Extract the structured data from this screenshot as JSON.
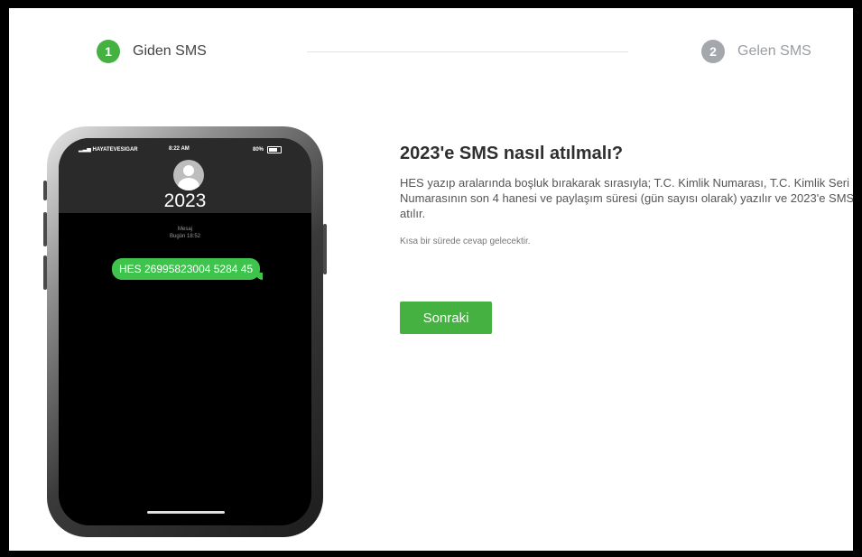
{
  "stepper": {
    "steps": [
      {
        "number": "1",
        "label": "Giden SMS",
        "state": "active"
      },
      {
        "number": "2",
        "label": "Gelen SMS",
        "state": "inactive"
      }
    ]
  },
  "phone": {
    "status_bar": {
      "carrier": "HAYATEVESIGAR",
      "time": "8:22 AM",
      "battery": "80%"
    },
    "contact_name": "2023",
    "message_label": "Mesaj",
    "message_time": "Bugün 18:52",
    "sms_text": "HES 26995823004 5284 45"
  },
  "content": {
    "title": "2023'e SMS nasıl atılmalı?",
    "description": "HES yazıp aralarında boşluk bırakarak sırasıyla; T.C. Kimlik Numarası, T.C. Kimlik Seri Numarasının son 4 hanesi ve paylaşım süresi (gün sayısı olarak) yazılır ve 2023'e SMS atılır.",
    "note": "Kısa bir sürede cevap gelecektir.",
    "next_button": "Sonraki"
  },
  "colors": {
    "accent": "#45b140",
    "inactive_step": "#a4a7ab",
    "sms_bubble": "#3ec44c"
  }
}
